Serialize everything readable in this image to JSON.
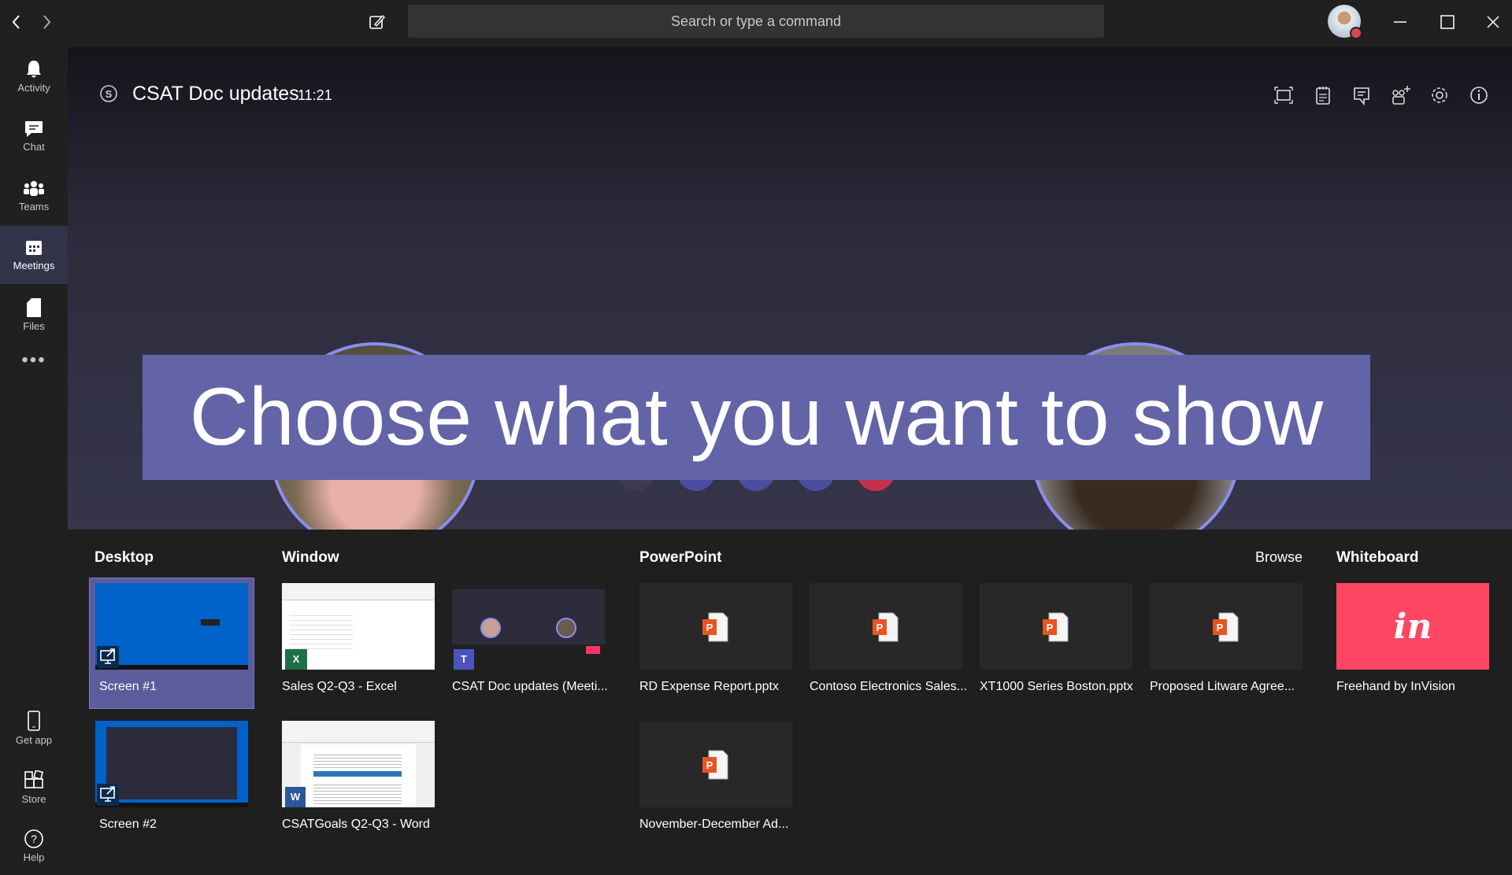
{
  "topbar": {
    "search_placeholder": "Search or type a command"
  },
  "sidebar": {
    "items": [
      {
        "label": "Activity",
        "icon": "bell-icon"
      },
      {
        "label": "Chat",
        "icon": "chat-icon"
      },
      {
        "label": "Teams",
        "icon": "teams-icon"
      },
      {
        "label": "Meetings",
        "icon": "calendar-icon",
        "active": true
      },
      {
        "label": "Files",
        "icon": "file-icon"
      }
    ],
    "bottom_items": [
      {
        "label": "Get app"
      },
      {
        "label": "Store"
      },
      {
        "label": "Help"
      }
    ]
  },
  "meeting": {
    "title": "CSAT Doc updates",
    "time": "11:21"
  },
  "banner": {
    "text": "Choose what you want to show"
  },
  "share": {
    "desktop": {
      "header": "Desktop",
      "items": [
        "Screen #1",
        "Screen #2"
      ],
      "selected": "Screen #1"
    },
    "window": {
      "header": "Window",
      "items": [
        "Sales Q2-Q3 - Excel",
        "CSAT Doc updates (Meeti...",
        "CSATGoals Q2-Q3 - Word"
      ]
    },
    "powerpoint": {
      "header": "PowerPoint",
      "browse": "Browse",
      "items": [
        "RD Expense Report.pptx",
        "Contoso Electronics Sales...",
        "XT1000 Series Boston.pptx",
        "Proposed Litware Agree...",
        "November-December Ad..."
      ]
    },
    "whiteboard": {
      "header": "Whiteboard",
      "items": [
        "Freehand by InVision"
      ],
      "logo": "in"
    }
  },
  "colors": {
    "accent": "#6264a7",
    "selected": "#5b5c9b",
    "invision": "#ff3366",
    "ppt": "#e8541f",
    "presence_busy": "#d74654"
  }
}
